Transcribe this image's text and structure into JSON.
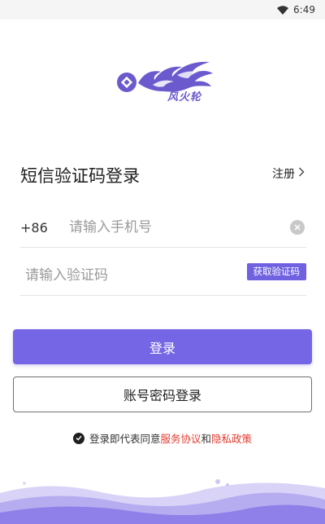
{
  "status_bar": {
    "time": "6:49",
    "icons": [
      "wifi-icon"
    ]
  },
  "brand": {
    "logo_text": "风火轮",
    "accent_color": "#7466e4"
  },
  "login": {
    "heading": "短信验证码登录",
    "register_label": "注册",
    "country_code": "+86",
    "phone_placeholder": "请输入手机号",
    "code_placeholder": "请输入验证码",
    "get_code_label": "获取验证码",
    "login_button": "登录",
    "password_login_button": "账号密码登录"
  },
  "agreement": {
    "prefix": "登录即代表同意",
    "service_link": "服务协议",
    "conjunction": "和",
    "privacy_link": "隐私政策",
    "link_color": "#e23b2e"
  }
}
